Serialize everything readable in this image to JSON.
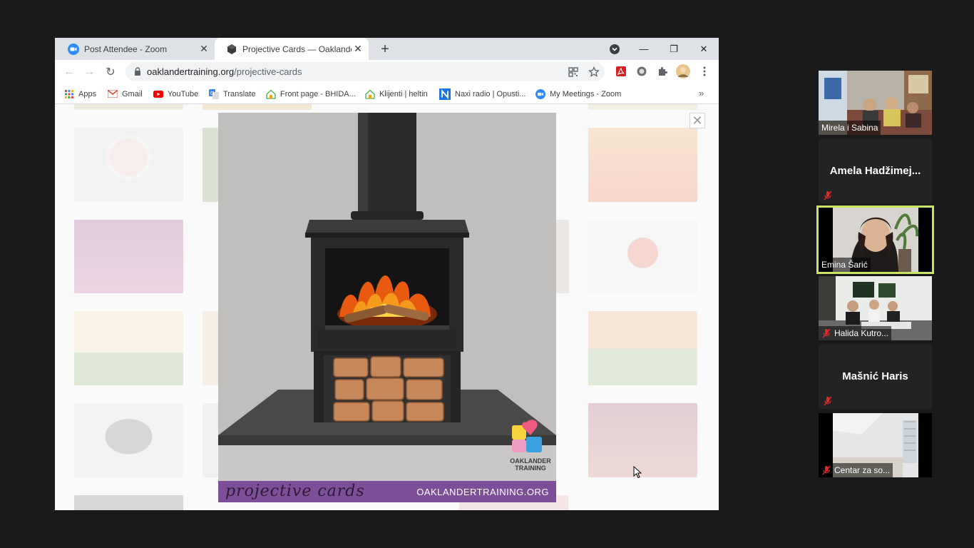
{
  "browser": {
    "tabs": [
      {
        "title": "Post Attendee - Zoom",
        "close": "✕"
      },
      {
        "title": "Projective Cards — OaklanderTra",
        "close": "✕"
      }
    ],
    "new_tab": "+",
    "window": {
      "minimize": "—",
      "restore": "❐",
      "close": "✕"
    },
    "nav": {
      "back": "←",
      "forward": "→",
      "reload": "↻"
    },
    "omnibox": {
      "domain": "oaklandertraining.org",
      "path": "/projective-cards"
    },
    "bookmarks": [
      {
        "label": "Apps",
        "icon": "apps-grid-icon"
      },
      {
        "label": "Gmail",
        "icon": "gmail-icon"
      },
      {
        "label": "YouTube",
        "icon": "youtube-icon"
      },
      {
        "label": "Translate",
        "icon": "translate-icon"
      },
      {
        "label": "Front page - BHIDA...",
        "icon": "house-icon"
      },
      {
        "label": "Klijenti | heltin",
        "icon": "house-icon"
      },
      {
        "label": "Naxi radio | Opusti...",
        "icon": "naxi-n-icon"
      },
      {
        "label": "My Meetings - Zoom",
        "icon": "zoom-icon"
      }
    ],
    "bookmarks_more": "»"
  },
  "page": {
    "overlay_close": "✕",
    "card": {
      "script_text": "projective cards",
      "site_text": "OAKLANDERTRAINING.ORG",
      "brand_line1": "OAKLANDER",
      "brand_line2": "TRAINING"
    }
  },
  "zoom": {
    "participants": [
      {
        "name": "Mirela i Sabina",
        "video": true,
        "muted": false,
        "active": false
      },
      {
        "name": "Amela  Hadžimej...",
        "video": false,
        "muted": true,
        "active": false
      },
      {
        "name": "Emina Šarić",
        "video": true,
        "muted": false,
        "active": true
      },
      {
        "name": "Halida Kutro...",
        "video": true,
        "muted": true,
        "active": false
      },
      {
        "name": "Mašnić Haris",
        "video": false,
        "muted": true,
        "active": false
      },
      {
        "name": "Centar za so...",
        "video": true,
        "muted": true,
        "active": false
      }
    ]
  },
  "colors": {
    "tabstrip": "#dee1e6",
    "card_footer": "#7d4f98",
    "active_speaker": "#c9e265",
    "zoom_blue": "#2d8cff"
  }
}
